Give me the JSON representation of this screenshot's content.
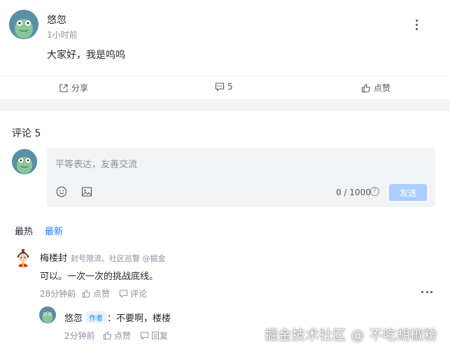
{
  "post": {
    "author": "悠忽",
    "time": "1小时前",
    "content": "大家好，我是呜呜",
    "actions": {
      "share_label": "分享",
      "comment_count": "5",
      "like_label": "点赞"
    }
  },
  "comments": {
    "title": "评论 5",
    "editor": {
      "placeholder": "平等表达，友善交流",
      "counter": "0 / 1000",
      "help": "?",
      "send_label": "发送"
    },
    "sort": {
      "hot": "最热",
      "new": "最新",
      "active": "new"
    },
    "items": [
      {
        "author": "梅楼封",
        "badge": "封号限流、社区巡警 @掘金",
        "text": "可以。一次一次的挑战底线。",
        "time": "28分钟前",
        "like_label": "点赞",
        "reply_label": "评论",
        "replies": [
          {
            "author": "悠忽",
            "tag": "作者",
            "text": "：不要啊，楼楼",
            "time": "2分钟前",
            "like_label": "点赞",
            "reply_label": "回复"
          }
        ]
      }
    ]
  },
  "watermark": "掘金技术社区 @ 不吃胡椒粉",
  "colors": {
    "accent": "#1e80ff",
    "send_disabled": "#abcdff",
    "band": "#f2f3f5"
  },
  "icons": [
    "share-icon",
    "comment-icon",
    "like-icon",
    "emoji-icon",
    "image-icon",
    "more-icon"
  ]
}
